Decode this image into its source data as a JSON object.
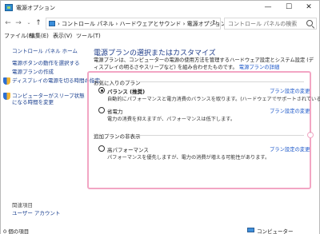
{
  "window": {
    "title": "電源オプション",
    "minimize_glyph": "—",
    "maximize_glyph": "☐",
    "close_glyph": "✕"
  },
  "address": {
    "breadcrumb": "›  コントロール パネル  ›  ハードウェアとサウンド  ›  電源オプション",
    "dropdown_glyph": "⌄",
    "refresh_glyph": "↻",
    "search_placeholder": "コントロール パネルの検索",
    "back_glyph": "←",
    "forward_glyph": "→",
    "recent_glyph": "⌄",
    "up_glyph": "↑"
  },
  "menu": {
    "items": [
      "ファイル(F)",
      "編集(E)",
      "表示(V)",
      "ツール(T)"
    ]
  },
  "sidebar": {
    "home": "コントロール パネル ホーム",
    "links": [
      "電源ボタンの動作を選択する",
      "電源プランの作成",
      "ディスプレイの電源を切る時間の指定",
      "コンピューターがスリープ状態になる時間を変更"
    ],
    "see_also": "関連項目",
    "user_accounts": "ユーザー アカウント"
  },
  "main": {
    "title": "電源プランの選択またはカスタマイズ",
    "description": "電源プランは、コンピューターの電源の使用方法を管理するハードウェア設定とシステム設定 (ディスプレイの明るさやスリープなど) を組み合わせたものです。",
    "description_link": "電源プランの詳細",
    "favorites_header": "お気に入りのプラン",
    "hidden_header": "追加プランの非表示",
    "collapse_glyph": "ˆ",
    "plans": [
      {
        "name": "バランス (推奨)",
        "desc": "自動的にパフォーマンスと電力消費のバランスを取ります。(ハードウェアでサポートされている場合)",
        "change_link": "プラン設定の変更",
        "selected": true
      },
      {
        "name": "省電力",
        "desc": "電力の消費を抑えますが、パフォーマンスは低下します。",
        "change_link": "プラン設定の変更",
        "selected": false
      },
      {
        "name": "高パフォーマンス",
        "desc": "パフォーマンスを優先しますが、電力の消費が増える可能性があります。",
        "change_link": "プラン設定の変更",
        "selected": false
      }
    ]
  },
  "status": {
    "items_count": "0 個の項目",
    "location": "コンピューター"
  },
  "colors": {
    "highlight_border": "#f2a6c4",
    "link": "#1a56c8",
    "title": "#1e3c8a"
  }
}
